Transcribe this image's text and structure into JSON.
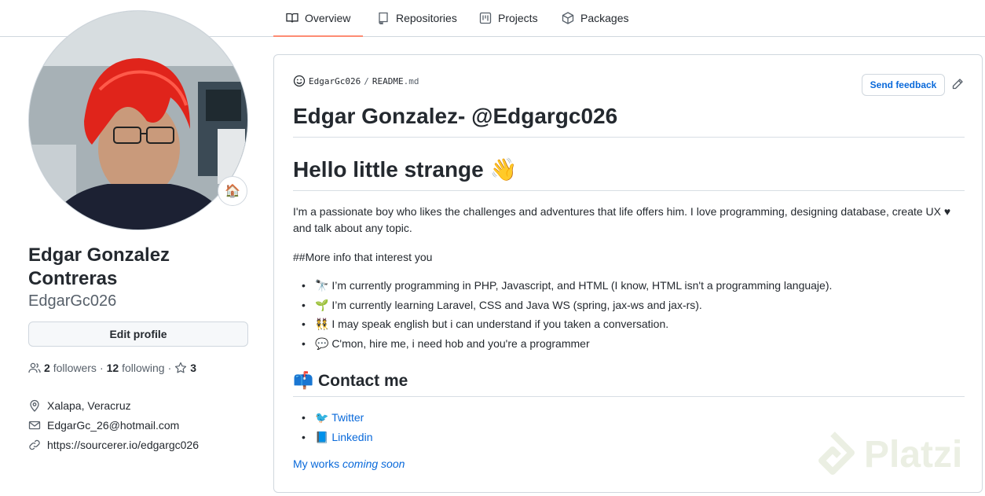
{
  "nav": {
    "tabs": [
      {
        "label": "Overview",
        "icon": "book-icon",
        "active": true
      },
      {
        "label": "Repositories",
        "icon": "repo-icon",
        "active": false
      },
      {
        "label": "Projects",
        "icon": "project-icon",
        "active": false
      },
      {
        "label": "Packages",
        "icon": "package-icon",
        "active": false
      }
    ]
  },
  "profile": {
    "fullname": "Edgar Gonzalez Contreras",
    "username": "EdgarGc026",
    "status_emoji": "🏠",
    "edit_label": "Edit profile",
    "followers_count": "2",
    "followers_label": "followers",
    "separator": "·",
    "following_count": "12",
    "following_label": "following",
    "stars_count": "3",
    "location": "Xalapa, Veracruz",
    "email": "EdgarGc_26@hotmail.com",
    "website": "https://sourcerer.io/edgargc026"
  },
  "readme": {
    "path_user": "EdgarGc026",
    "path_sep": "/",
    "path_file": "README",
    "path_ext": ".md",
    "feedback_label": "Send feedback",
    "title": "Edgar Gonzalez- @Edgargc026",
    "greeting": "Hello little strange 👋",
    "intro": "I'm a passionate boy who likes the challenges and adventures that life offers him. I love programming, designing database, create UX ♥ and talk about any topic.",
    "more_info": "##More info that interest you",
    "bullets": [
      "🔭 I’m currently programming in PHP, Javascript, and HTML (I know, HTML isn't a programming languaje).",
      "🌱 I’m currently learning Laravel, CSS and Java WS (spring, jax-ws and jax-rs).",
      "👯 I may speak english but i can understand if you taken a conversation.",
      "💬 C'mon, hire me, i need hob and you're a programmer"
    ],
    "contact_heading": "📫 Contact me",
    "contacts": [
      {
        "emoji": "🐦",
        "label": "Twitter"
      },
      {
        "emoji": "📘",
        "label": "Linkedin"
      }
    ],
    "works_text": "My works",
    "works_em": "coming soon"
  },
  "watermark": "Platzi",
  "colors": {
    "accent_tab": "#fd8c73",
    "link": "#0969da",
    "border": "#d0d7de",
    "muted": "#57606a"
  }
}
